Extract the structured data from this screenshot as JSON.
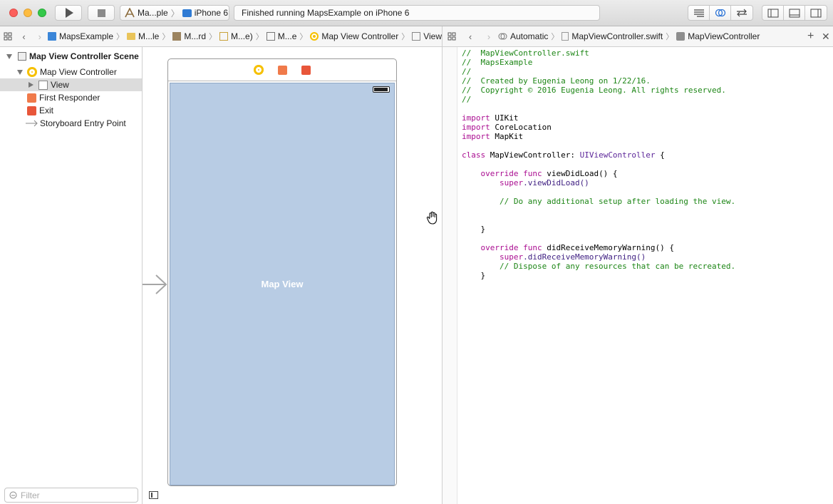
{
  "toolbar": {
    "scheme_target": "Ma...ple",
    "device": "iPhone 6",
    "status": "Finished running MapsExample on iPhone 6"
  },
  "left_jumpbar": {
    "crumbs": [
      "MapsExample",
      "M...le",
      "M...rd",
      "M...e)",
      "M...e",
      "Map View Controller",
      "View"
    ]
  },
  "right_jumpbar": {
    "crumbs": [
      "Automatic",
      "MapViewController.swift",
      "MapViewController"
    ]
  },
  "outline": {
    "scene": "Map View Controller Scene",
    "controller": "Map View Controller",
    "view": "View",
    "first_responder": "First Responder",
    "exit": "Exit",
    "entry_point": "Storyboard Entry Point",
    "filter_placeholder": "Filter"
  },
  "canvas": {
    "map_view_label": "Map View"
  },
  "code": {
    "l1": "//  MapViewController.swift",
    "l2": "//  MapsExample",
    "l3": "//",
    "l4": "//  Created by Eugenia Leong on 1/22/16.",
    "l5": "//  Copyright © 2016 Eugenia Leong. All rights reserved.",
    "l6": "//",
    "import_kw": "import",
    "uikit": " UIKit",
    "corelocation": " CoreLocation",
    "mapkit": " MapKit",
    "class_kw": "class",
    "class_name": " MapViewController: ",
    "superclass": "UIViewController",
    "open_brace": " {",
    "override_kw": "    override func",
    "vdl_sig": " viewDidLoad() {",
    "super_kw": "        super",
    "vdl_call": ".viewDidLoad()",
    "vdl_comment": "        // Do any additional setup after loading the view.",
    "close_inner": "    }",
    "drmw_sig": " didReceiveMemoryWarning() {",
    "drmw_call": ".didReceiveMemoryWarning()",
    "drmw_comment": "        // Dispose of any resources that can be recreated.",
    "close_inner2": "    }"
  }
}
